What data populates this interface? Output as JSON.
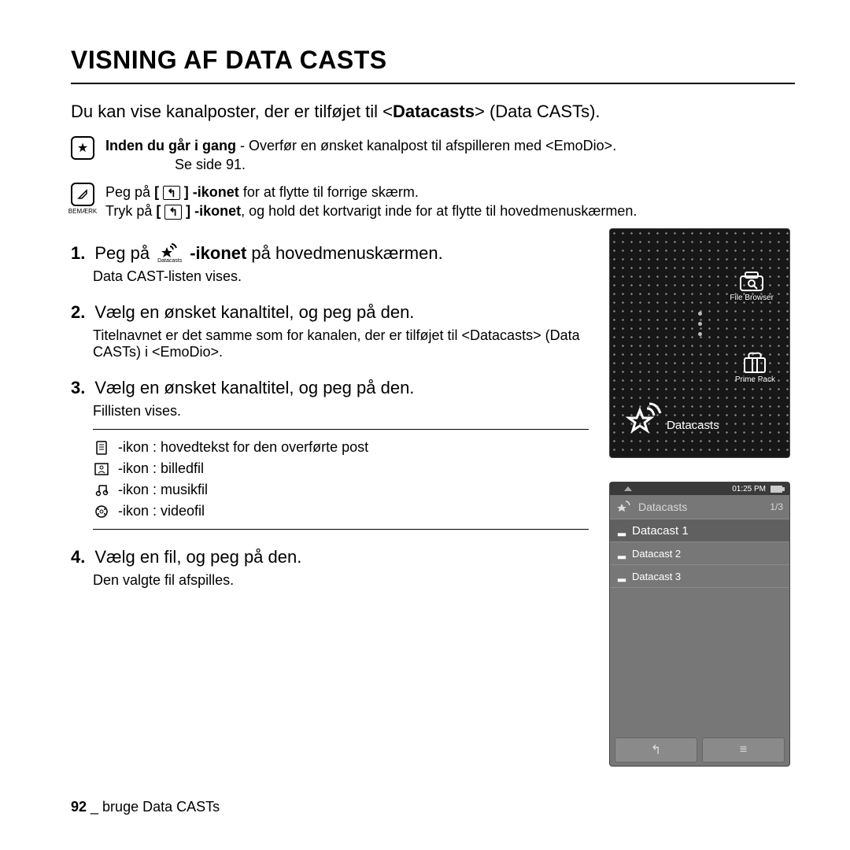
{
  "title": "VISNING AF DATA CASTS",
  "intro_prefix": "Du kan vise kanalposter, der er tilføjet til <",
  "intro_bold": "Datacasts",
  "intro_suffix": "> (Data CASTs).",
  "pre_label": "Inden du går i gang",
  "pre_body_1": " - Overfør en ønsket kanalpost til afspilleren med <EmoDio>.",
  "pre_body_2": "Se side 91.",
  "note_label": "BEMÆRK",
  "note_line1_a": "Peg på ",
  "note_line1_b": " -ikonet",
  "note_line1_c": " for at flytte til forrige skærm.",
  "note_line2_a": "Tryk på ",
  "note_line2_b": " -ikonet",
  "note_line2_c": ", og hold det kortvarigt inde for at flytte til hovedmenuskærmen.",
  "back_glyph": "↰",
  "steps": {
    "s1_a": "Peg på ",
    "s1_b": " -ikonet",
    "s1_c": " på hovedmenuskærmen.",
    "s1_icon_caption": "Datacasts",
    "s1_sub": "Data CAST-listen vises.",
    "s2": "Vælg en ønsket kanaltitel, og peg på den.",
    "s2_sub": "Titelnavnet er det samme som for kanalen, der er tilføjet til <Datacasts> (Data CASTs) i <EmoDio>.",
    "s3": "Vælg en ønsket kanaltitel, og peg på den.",
    "s3_sub": "Fillisten vises.",
    "ic_text": " -ikon : hovedtekst for den overførte post",
    "ic_image": " -ikon : billedfil",
    "ic_music": " -ikon : musikfil",
    "ic_video": " -ikon : videofil",
    "s4": "Vælg en fil, og peg på den.",
    "s4_sub": "Den valgte fil afspilles."
  },
  "device1": {
    "file_browser": "File Browser",
    "prime_pack": "Prime Pack",
    "datacasts": "Datacasts"
  },
  "device2": {
    "time": "01:25 PM",
    "header": "Datacasts",
    "count": "1/3",
    "rows": [
      "Datacast 1",
      "Datacast 2",
      "Datacast 3"
    ],
    "back": "↰",
    "menu": "≡"
  },
  "footer_page": "92",
  "footer_sep": " _ ",
  "footer_text": "bruge Data CASTs"
}
